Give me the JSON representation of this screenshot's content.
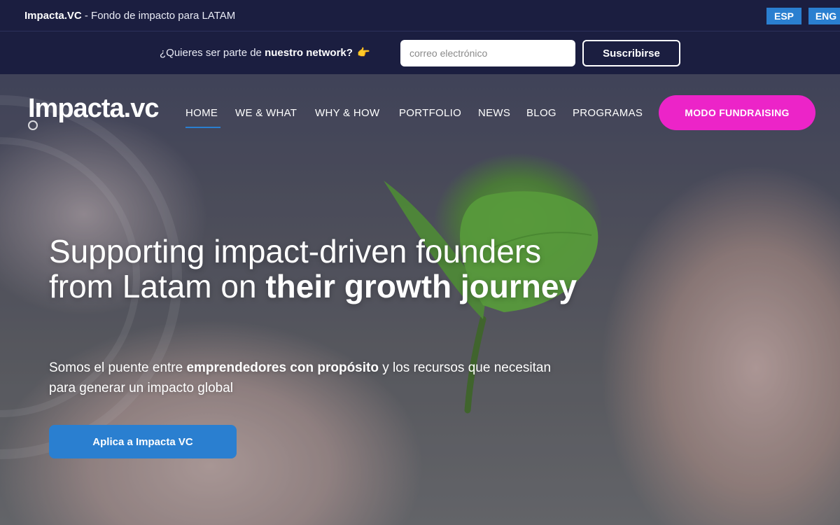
{
  "top_strip": {
    "brand": "Impacta.VC",
    "tagline": " - Fondo de impacto para LATAM",
    "languages": [
      "ESP",
      "ENG"
    ]
  },
  "newsletter": {
    "text_before": "¿Quieres ser parte de ",
    "text_bold": "nuestro network?",
    "emoji": "👉",
    "email_placeholder": "correo electrónico",
    "subscribe_label": "Suscribirse"
  },
  "nav": {
    "logo_main": "Impacta",
    "logo_dot": ".",
    "logo_vc": "vc",
    "items": [
      "HOME",
      "WE & WHAT",
      "WHY & HOW",
      "PORTFOLIO",
      "NEWS",
      "BLOG",
      "PROGRAMAS"
    ],
    "active": "HOME",
    "cta_label": "MODO FUNDRAISING"
  },
  "hero": {
    "headline_regular": "Supporting impact-driven founders from Latam on ",
    "headline_bold": "their growth journey",
    "sub_before": "Somos el puente entre ",
    "sub_bold": "emprendedores con propósito",
    "sub_after": " y los recursos que necesitan para generar un impacto global",
    "apply_label": "Aplica a Impacta VC"
  },
  "colors": {
    "navy": "#1b1e40",
    "blue": "#2a7fd0",
    "magenta": "#ec24c8"
  }
}
